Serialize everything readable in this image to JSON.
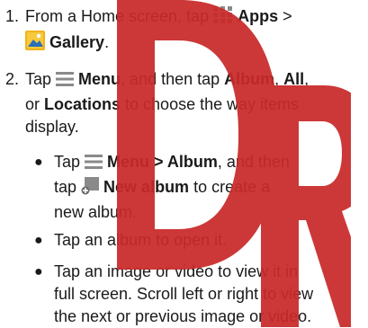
{
  "steps": [
    {
      "number": "1.",
      "pre": "From a Home screen, tap ",
      "apps_label": "Apps",
      "sep": " >",
      "gallery_label": "Gallery",
      "gallery_tail": "."
    },
    {
      "number": "2.",
      "pre": "Tap ",
      "menu_label": "Menu",
      "mid": ", and then tap ",
      "album_label": "Album",
      "comma1": ", ",
      "all_label": "All",
      "comma2": ",",
      "or": "or ",
      "locations_label": "Locations",
      "tail": " to choose the way items",
      "tail2": "display."
    }
  ],
  "bullets": [
    {
      "pre": "Tap ",
      "menu_label": "Menu > Album",
      "mid": ", and then",
      "tap2": "tap ",
      "new_album_label": "New album",
      "tail": " to create a",
      "tail2": "new album."
    },
    {
      "text": "Tap an album to open it."
    },
    {
      "line1": "Tap an image or video to view it in",
      "line2": "full screen. Scroll left or right to view",
      "line3": "the next or previous image or video."
    }
  ],
  "bullet_char": "●",
  "colors": {
    "watermark": "#c92a2a",
    "apps_icon": "#8a8a8a",
    "gallery_icon": "#f2b21b",
    "menu_icon": "#8a8a8a"
  },
  "icons": [
    "apps-grid-icon",
    "gallery-icon",
    "menu-icon",
    "new-album-icon"
  ]
}
